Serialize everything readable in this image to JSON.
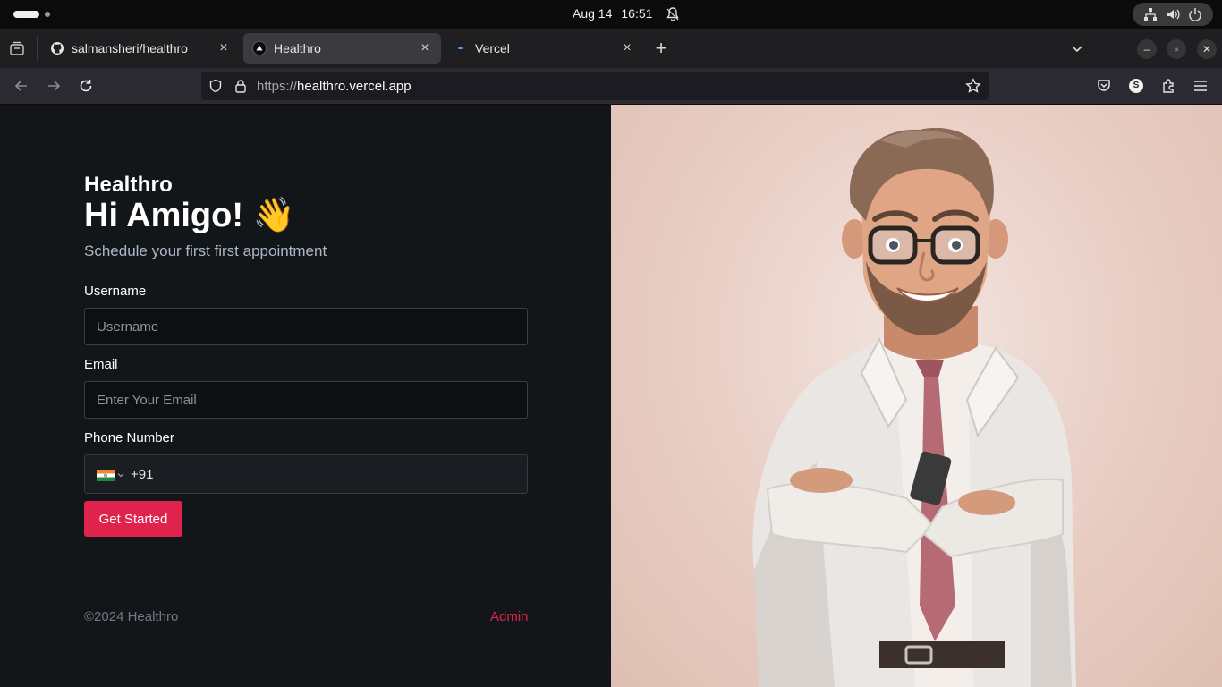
{
  "os": {
    "date": "Aug 14",
    "time": "16:51"
  },
  "browser": {
    "tabs": [
      {
        "label": "salmansheri/healthro",
        "favicon": "github-icon"
      },
      {
        "label": "Healthro",
        "favicon": "triangle-icon",
        "active": true
      },
      {
        "label": "Vercel",
        "favicon": "vercel-dot-icon"
      }
    ],
    "url_scheme": "https://",
    "url_host": "healthro.vercel.app",
    "profile_initial": "S"
  },
  "page": {
    "brand": "Healthro",
    "greeting": "Hi Amigo! 👋",
    "subtitle": "Schedule your first first appointment",
    "username": {
      "label": "Username",
      "placeholder": "Username",
      "value": ""
    },
    "email": {
      "label": "Email",
      "placeholder": "Enter Your Email",
      "value": ""
    },
    "phone": {
      "label": "Phone Number",
      "country": "India",
      "value": "+91"
    },
    "cta_label": "Get Started",
    "copyright": "©2024 Healthro",
    "admin_label": "Admin",
    "hero_image": "doctor-illustration"
  },
  "colors": {
    "accent": "#e0234d",
    "left_bg": "#131619",
    "right_bg": "#e8cdc3"
  }
}
